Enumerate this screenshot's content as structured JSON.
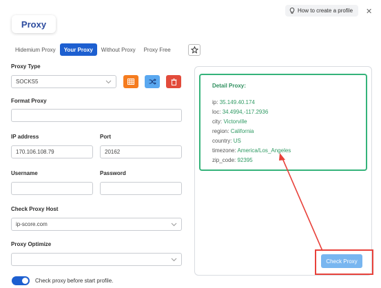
{
  "header": {
    "title": "Proxy",
    "help_link": "How to create a profile"
  },
  "tabs": [
    {
      "label": "Hidemium Proxy",
      "active": false
    },
    {
      "label": "Your Proxy",
      "active": true
    },
    {
      "label": "Without Proxy",
      "active": false
    },
    {
      "label": "Proxy Free",
      "active": false
    }
  ],
  "form": {
    "proxy_type_label": "Proxy Type",
    "proxy_type_value": "SOCKS5",
    "format_proxy_label": "Format Proxy",
    "format_proxy_value": "",
    "ip_label": "IP address",
    "ip_value": "170.106.108.79",
    "port_label": "Port",
    "port_value": "20162",
    "username_label": "Username",
    "username_value": "",
    "password_label": "Password",
    "password_value": "",
    "check_host_label": "Check Proxy Host",
    "check_host_value": "ip-score.com",
    "optimize_label": "Proxy Optimize",
    "optimize_value": "",
    "check_before_start": "Check proxy before start profile.",
    "check_before_start_enabled": true
  },
  "detail": {
    "title": "Detail Proxy:",
    "rows": [
      {
        "key": "ip:",
        "value": "35.149.40.174"
      },
      {
        "key": "loc:",
        "value": "34.4994,-117.2936"
      },
      {
        "key": "city:",
        "value": "Victorville"
      },
      {
        "key": "region:",
        "value": "California"
      },
      {
        "key": "country:",
        "value": "US"
      },
      {
        "key": "timezone:",
        "value": "America/Los_Angeles"
      },
      {
        "key": "zip_code:",
        "value": "92395"
      }
    ]
  },
  "check_button": "Check Proxy",
  "colors": {
    "accent": "#1d5fd0",
    "detail_green": "#34b37a",
    "highlight_red": "#e8413a",
    "orange_btn": "#f57c1f",
    "blue_btn": "#5aa8f0",
    "red_btn": "#e24b3b"
  }
}
